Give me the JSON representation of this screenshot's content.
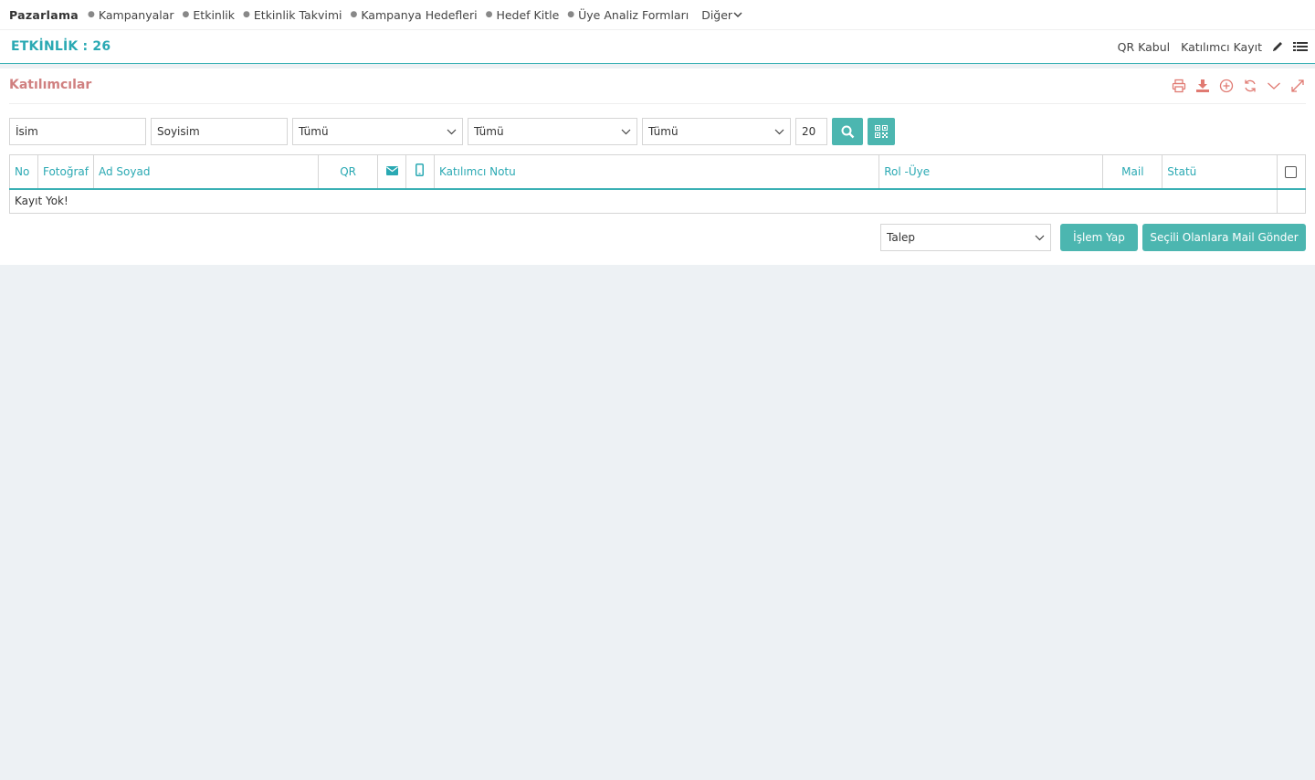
{
  "topnav": {
    "brand": "Pazarlama",
    "items": [
      "Kampanyalar",
      "Etkinlik",
      "Etkinlik Takvimi",
      "Kampanya Hedefleri",
      "Hedef Kitle",
      "Üye Analiz Formları"
    ],
    "more": "Diğer"
  },
  "header": {
    "title": "ETKİNLİK : 26",
    "links": [
      "QR Kabul",
      "Katılımcı Kayıt"
    ]
  },
  "panel": {
    "title": "Katılımcılar",
    "tools": [
      "print-icon",
      "download-icon",
      "add-circle-icon",
      "refresh-icon",
      "collapse-icon",
      "expand-icon"
    ]
  },
  "filters": {
    "name_placeholder": "İsim",
    "surname_placeholder": "Soyisim",
    "select1": "Tümü",
    "select2": "Tümü",
    "select3": "Tümü",
    "page_size": "20"
  },
  "table": {
    "headers": {
      "no": "No",
      "photo": "Fotoğraf",
      "name": "Ad Soyad",
      "qr": "QR",
      "note": "Katılımcı Notu",
      "role": "Rol -Üye",
      "mail": "Mail",
      "status": "Statü"
    },
    "empty_text": "Kayıt Yok!"
  },
  "actions": {
    "select_value": "Talep",
    "process_button": "İşlem Yap",
    "send_mail_button": "Seçili Olanlara Mail Gönder"
  },
  "colors": {
    "accent": "#2aa9b3",
    "button": "#4cb6b0",
    "panel_title": "#d08080",
    "tool_icons": "#e07a72"
  }
}
